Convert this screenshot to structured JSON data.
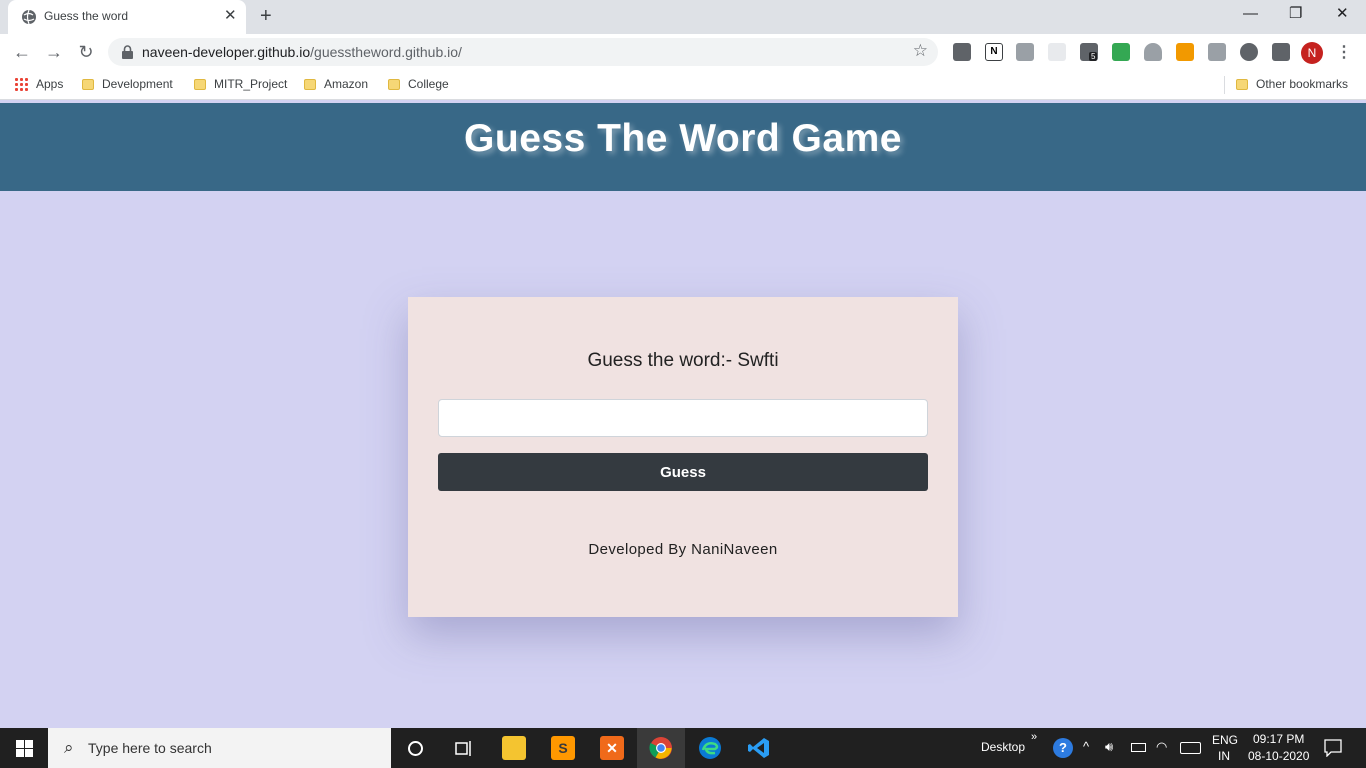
{
  "browser": {
    "tab_title": "Guess the word",
    "tab_close": "✕",
    "new_tab": "+",
    "window_controls": {
      "minimize": "—",
      "restore": "❐",
      "close": "✕"
    },
    "nav": {
      "back": "←",
      "forward": "→",
      "reload": "↻"
    },
    "url_host": "naveen-developer.github.io",
    "url_path": "/guesstheword.github.io/",
    "star": "☆",
    "profile_initial": "N",
    "menu": "⋮",
    "extensions": [
      {
        "name": "extension-icon-1",
        "color": "#5f6368"
      },
      {
        "name": "extension-icon-nj",
        "color": "#3c4043"
      },
      {
        "name": "camera-icon",
        "color": "#9aa0a6"
      },
      {
        "name": "extension-icon-grid",
        "color": "#e8eaed"
      },
      {
        "name": "extension-icon-badge",
        "color": "#5f6368"
      },
      {
        "name": "tv-icon",
        "color": "#34a853"
      },
      {
        "name": "download-icon",
        "color": "#9aa0a6"
      },
      {
        "name": "extension-icon-orange",
        "color": "#f29900"
      },
      {
        "name": "extension-icon-r",
        "color": "#9aa0a6"
      },
      {
        "name": "extension-icon-circle",
        "color": "#5f6368"
      },
      {
        "name": "puzzle-icon",
        "color": "#5f6368"
      }
    ],
    "extension_badge": "5",
    "bookmarks": [
      "Apps",
      "Development",
      "MITR_Project",
      "Amazon",
      "College"
    ],
    "other_bookmarks": "Other bookmarks"
  },
  "page": {
    "title": "Guess The Word Game",
    "prompt": "Guess the word:- Swfti",
    "input_value": "",
    "button_label": "Guess",
    "credit": "Developed By NaniNaveen",
    "colors": {
      "header": "#386887",
      "background": "#d3d2f2",
      "card": "#f0e2e1",
      "button": "#343a40"
    }
  },
  "taskbar": {
    "search_placeholder": "Type here to search",
    "desktop_label": "Desktop",
    "chevron": "»",
    "language": "ENG",
    "region": "IN",
    "time": "09:17 PM",
    "date": "08-10-2020"
  }
}
